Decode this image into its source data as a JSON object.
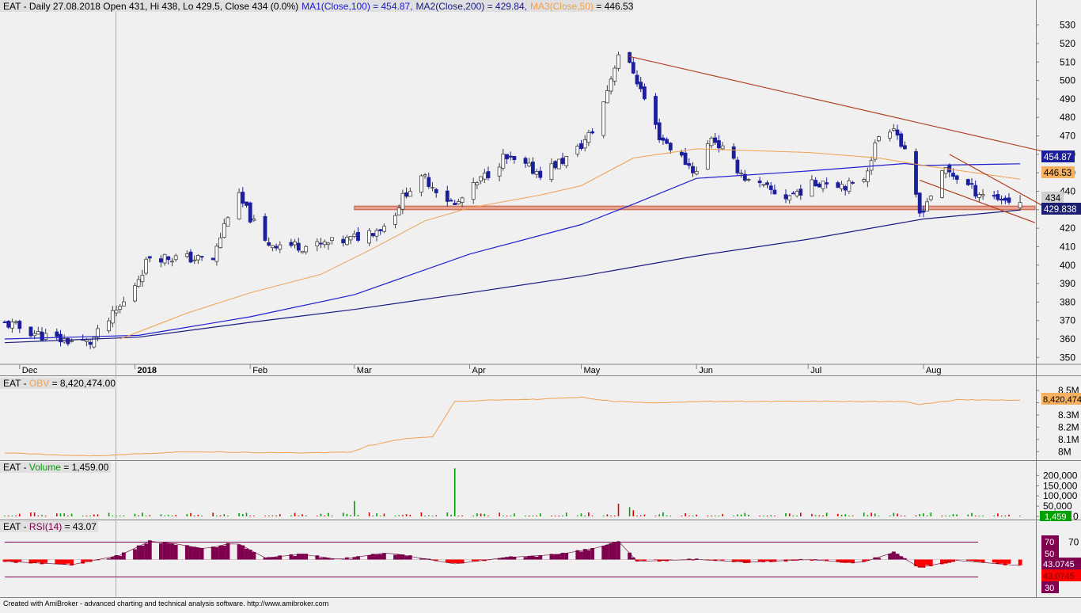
{
  "price_pane": {
    "header": {
      "prefix": "EAT - Daily 27.08.2018 Open 431, Hi 438, Lo 429.5, Close 434 (0.0%)",
      "ma1": "MA1(Close,100) = 454.87,",
      "ma2": "MA2(Close,200) = 429.84,",
      "ma3": "MA3(Close,50)",
      "ma3_value": " = 446.53"
    },
    "y_ticks": [
      "350",
      "360",
      "370",
      "380",
      "390",
      "400",
      "410",
      "420",
      "430",
      "440",
      "450",
      "460",
      "470",
      "480",
      "490",
      "500",
      "510",
      "520",
      "530"
    ],
    "month_labels": [
      "Dec",
      "2018",
      "Feb",
      "Mar",
      "Apr",
      "May",
      "Jun",
      "Jul",
      "Aug"
    ],
    "badges": {
      "ma1": "454.87",
      "ma3": "446.53",
      "close": "434",
      "ma2": "429.838"
    }
  },
  "obv_pane": {
    "header_prefix": "EAT - ",
    "header_name": "OBV",
    "header_value": " = 8,420,474.00",
    "y_ticks": [
      "8.5M",
      "8.4M",
      "8.3M",
      "8.2M",
      "8.1M",
      "8M"
    ],
    "badge": "8,420,474"
  },
  "volume_pane": {
    "header_prefix": "EAT - ",
    "header_name": "Volume",
    "header_value": " = 1,459.00",
    "y_ticks": [
      "200,000",
      "150,000",
      "100,000",
      "50,000",
      "0"
    ],
    "badge": "1,459"
  },
  "rsi_pane": {
    "header_prefix": "EAT - ",
    "header_name": "RSI(14)",
    "header_value": " = 43.07",
    "y_ticks": [
      "70"
    ],
    "badges": {
      "b70": "70",
      "b50": "50",
      "b43a": "43.0745",
      "b43b": "43.0745",
      "b30": "30"
    }
  },
  "footer": "Created with AmiBroker - advanced charting and technical analysis software. http://www.amibroker.com",
  "colors": {
    "background": "#f0f0f0",
    "up_candle": "#ffffff",
    "down_candle": "#1c1f9b",
    "ma1": "#2020d0",
    "ma2": "#1a1a80",
    "ma3": "#f0a050",
    "trendline": "#b04020",
    "support_zone": "#e8a090",
    "obv": "#f0a050",
    "vol_up": "#00a000",
    "vol_down": "#e00000",
    "rsi_above": "#800050",
    "rsi_below": "#ff0000"
  },
  "chart_data": [
    {
      "type": "candlestick",
      "title": "EAT - Daily 27.08.2018",
      "ylim": [
        348,
        535
      ],
      "x_range": [
        "2017-11-27",
        "2018-08-27"
      ],
      "anchors": [
        {
          "date": "2017-11-28",
          "close": 368
        },
        {
          "date": "2017-12-10",
          "close": 360
        },
        {
          "date": "2017-12-20",
          "close": 358
        },
        {
          "date": "2017-12-30",
          "close": 382
        },
        {
          "date": "2018-01-05",
          "close": 405
        },
        {
          "date": "2018-01-12",
          "close": 404
        },
        {
          "date": "2018-01-22",
          "close": 403
        },
        {
          "date": "2018-01-28",
          "close": 440
        },
        {
          "date": "2018-02-05",
          "close": 412
        },
        {
          "date": "2018-02-18",
          "close": 410
        },
        {
          "date": "2018-02-28",
          "close": 414
        },
        {
          "date": "2018-03-10",
          "close": 422
        },
        {
          "date": "2018-03-15",
          "close": 440
        },
        {
          "date": "2018-03-20",
          "close": 447
        },
        {
          "date": "2018-03-28",
          "close": 432
        },
        {
          "date": "2018-04-10",
          "close": 458
        },
        {
          "date": "2018-04-20",
          "close": 450
        },
        {
          "date": "2018-04-29",
          "close": 460
        },
        {
          "date": "2018-05-05",
          "close": 475
        },
        {
          "date": "2018-05-11",
          "close": 515
        },
        {
          "date": "2018-05-15",
          "close": 505
        },
        {
          "date": "2018-05-22",
          "close": 470
        },
        {
          "date": "2018-06-01",
          "close": 450
        },
        {
          "date": "2018-06-05",
          "close": 470
        },
        {
          "date": "2018-06-15",
          "close": 445
        },
        {
          "date": "2018-06-25",
          "close": 437
        },
        {
          "date": "2018-07-05",
          "close": 446
        },
        {
          "date": "2018-07-15",
          "close": 442
        },
        {
          "date": "2018-07-20",
          "close": 470
        },
        {
          "date": "2018-07-24",
          "close": 476
        },
        {
          "date": "2018-07-27",
          "close": 460
        },
        {
          "date": "2018-07-31",
          "close": 428
        },
        {
          "date": "2018-08-07",
          "close": 452
        },
        {
          "date": "2018-08-15",
          "close": 440
        },
        {
          "date": "2018-08-22",
          "close": 436
        },
        {
          "date": "2018-08-27",
          "close": 434
        }
      ],
      "last_bar": {
        "date": "2018-08-27",
        "open": 431,
        "high": 438,
        "low": 429.5,
        "close": 434
      },
      "moving_averages": [
        {
          "name": "MA1(Close,100)",
          "last": 454.87,
          "anchors": [
            {
              "date": "2017-11-27",
              "value": 360
            },
            {
              "date": "2018-01-02",
              "value": 362
            },
            {
              "date": "2018-02-01",
              "value": 372
            },
            {
              "date": "2018-03-01",
              "value": 384
            },
            {
              "date": "2018-04-01",
              "value": 406
            },
            {
              "date": "2018-05-01",
              "value": 422
            },
            {
              "date": "2018-05-15",
              "value": 433
            },
            {
              "date": "2018-06-01",
              "value": 447
            },
            {
              "date": "2018-07-01",
              "value": 451
            },
            {
              "date": "2018-07-27",
              "value": 455
            },
            {
              "date": "2018-08-01",
              "value": 454
            },
            {
              "date": "2018-08-27",
              "value": 454.87
            }
          ]
        },
        {
          "name": "MA2(Close,200)",
          "last": 429.84,
          "anchors": [
            {
              "date": "2017-11-27",
              "value": 358
            },
            {
              "date": "2018-01-02",
              "value": 361
            },
            {
              "date": "2018-02-01",
              "value": 369
            },
            {
              "date": "2018-03-01",
              "value": 376
            },
            {
              "date": "2018-04-01",
              "value": 385
            },
            {
              "date": "2018-05-01",
              "value": 394
            },
            {
              "date": "2018-06-01",
              "value": 405
            },
            {
              "date": "2018-07-01",
              "value": 414
            },
            {
              "date": "2018-08-01",
              "value": 425
            },
            {
              "date": "2018-08-27",
              "value": 429.84
            }
          ]
        },
        {
          "name": "MA3(Close,50)",
          "last": 446.53,
          "anchors": [
            {
              "date": "2017-12-28",
              "value": 360
            },
            {
              "date": "2018-01-15",
              "value": 374
            },
            {
              "date": "2018-02-01",
              "value": 385
            },
            {
              "date": "2018-02-20",
              "value": 395
            },
            {
              "date": "2018-03-05",
              "value": 408
            },
            {
              "date": "2018-03-20",
              "value": 424
            },
            {
              "date": "2018-04-01",
              "value": 431
            },
            {
              "date": "2018-04-20",
              "value": 438
            },
            {
              "date": "2018-05-01",
              "value": 443
            },
            {
              "date": "2018-05-15",
              "value": 458
            },
            {
              "date": "2018-06-01",
              "value": 463
            },
            {
              "date": "2018-07-01",
              "value": 461
            },
            {
              "date": "2018-07-20",
              "value": 458
            },
            {
              "date": "2018-08-01",
              "value": 454
            },
            {
              "date": "2018-08-27",
              "value": 446.53
            }
          ]
        }
      ],
      "trendlines": [
        {
          "from": {
            "date": "2018-05-14",
            "value": 513
          },
          "to": {
            "date": "2018-09-10",
            "value": 458
          }
        },
        {
          "from": {
            "date": "2018-08-08",
            "value": 460
          },
          "to": {
            "date": "2018-09-04",
            "value": 430
          }
        },
        {
          "from": {
            "date": "2018-07-31",
            "value": 446
          },
          "to": {
            "date": "2018-08-31",
            "value": 423
          }
        }
      ],
      "support_zone": {
        "from_date": "2018-03-01",
        "to_date": "2018-08-31",
        "low": 430,
        "high": 432
      }
    },
    {
      "type": "line",
      "name": "OBV",
      "last": 8420474,
      "ylim": [
        7950000,
        8520000
      ],
      "anchors": [
        {
          "date": "2017-11-27",
          "value": 7990000
        },
        {
          "date": "2017-12-20",
          "value": 7965000
        },
        {
          "date": "2018-01-15",
          "value": 8000000
        },
        {
          "date": "2018-02-10",
          "value": 7990000
        },
        {
          "date": "2018-02-28",
          "value": 7995000
        },
        {
          "date": "2018-03-05",
          "value": 8050000
        },
        {
          "date": "2018-03-15",
          "value": 8110000
        },
        {
          "date": "2018-03-22",
          "value": 8120000
        },
        {
          "date": "2018-03-28",
          "value": 8410000
        },
        {
          "date": "2018-04-05",
          "value": 8420000
        },
        {
          "date": "2018-04-20",
          "value": 8430000
        },
        {
          "date": "2018-05-01",
          "value": 8445000
        },
        {
          "date": "2018-05-10",
          "value": 8410000
        },
        {
          "date": "2018-05-20",
          "value": 8400000
        },
        {
          "date": "2018-06-01",
          "value": 8410000
        },
        {
          "date": "2018-07-01",
          "value": 8412000
        },
        {
          "date": "2018-07-27",
          "value": 8410000
        },
        {
          "date": "2018-07-31",
          "value": 8385000
        },
        {
          "date": "2018-08-10",
          "value": 8425000
        },
        {
          "date": "2018-08-27",
          "value": 8420474
        }
      ]
    },
    {
      "type": "bar",
      "name": "Volume",
      "last": 1459,
      "ylim": [
        0,
        240000
      ],
      "notable_bars": [
        {
          "date": "2018-03-01",
          "value": 75000,
          "direction": "up"
        },
        {
          "date": "2018-03-28",
          "value": 235000,
          "direction": "up"
        },
        {
          "date": "2018-05-11",
          "value": 62000,
          "direction": "down"
        },
        {
          "date": "2018-05-14",
          "value": 45000,
          "direction": "up"
        },
        {
          "date": "2018-05-15",
          "value": 30000,
          "direction": "down"
        },
        {
          "date": "2018-08-27",
          "value": 1459,
          "direction": "up"
        }
      ]
    },
    {
      "type": "area",
      "name": "RSI(14)",
      "last": 43.07,
      "levels": [
        70,
        50,
        30
      ],
      "anchors": [
        {
          "date": "2017-11-27",
          "value": 48
        },
        {
          "date": "2017-12-15",
          "value": 44
        },
        {
          "date": "2017-12-28",
          "value": 55
        },
        {
          "date": "2018-01-05",
          "value": 71
        },
        {
          "date": "2018-01-12",
          "value": 68
        },
        {
          "date": "2018-01-20",
          "value": 62
        },
        {
          "date": "2018-01-28",
          "value": 70
        },
        {
          "date": "2018-02-05",
          "value": 52
        },
        {
          "date": "2018-02-15",
          "value": 56
        },
        {
          "date": "2018-02-25",
          "value": 50
        },
        {
          "date": "2018-03-10",
          "value": 58
        },
        {
          "date": "2018-03-28",
          "value": 45
        },
        {
          "date": "2018-04-10",
          "value": 52
        },
        {
          "date": "2018-04-25",
          "value": 56
        },
        {
          "date": "2018-05-05",
          "value": 63
        },
        {
          "date": "2018-05-11",
          "value": 71
        },
        {
          "date": "2018-05-16",
          "value": 48
        },
        {
          "date": "2018-06-01",
          "value": 50
        },
        {
          "date": "2018-06-15",
          "value": 47
        },
        {
          "date": "2018-07-01",
          "value": 50
        },
        {
          "date": "2018-07-15",
          "value": 46
        },
        {
          "date": "2018-07-24",
          "value": 58
        },
        {
          "date": "2018-07-31",
          "value": 41
        },
        {
          "date": "2018-08-10",
          "value": 49
        },
        {
          "date": "2018-08-27",
          "value": 43.07
        }
      ]
    }
  ]
}
